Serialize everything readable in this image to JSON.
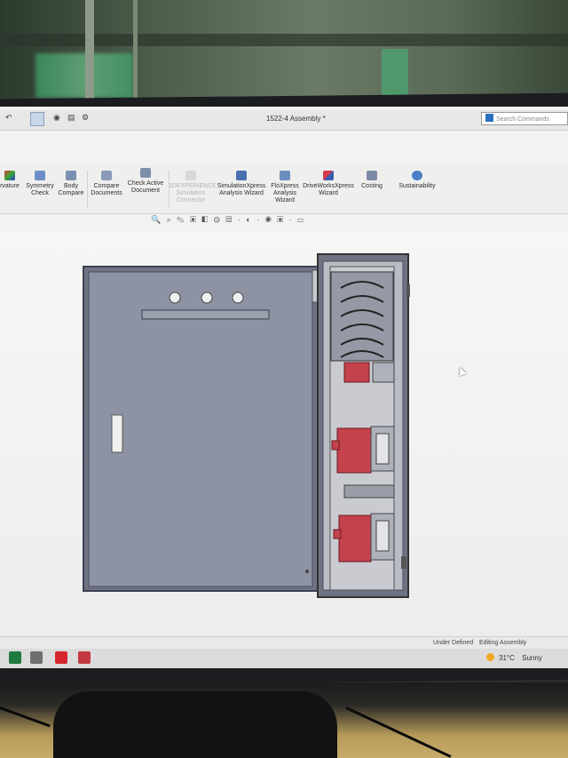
{
  "window": {
    "title": "1522-4 Assembly *"
  },
  "search": {
    "placeholder": "Search Commands"
  },
  "ribbon": {
    "items": [
      {
        "label": "rvature"
      },
      {
        "label": "Symmetry Check"
      },
      {
        "label": "Body Compare"
      },
      {
        "label": "Compare Documents"
      },
      {
        "label": "Check Active Document"
      },
      {
        "label": "3DEXPERIENCE Simulation Connector"
      },
      {
        "label": "SimulationXpress Analysis Wizard"
      },
      {
        "label": "FloXpress Analysis Wizard"
      },
      {
        "label": "DriveWorksXpress Wizard"
      },
      {
        "label": "Costing"
      },
      {
        "label": "Sustainability"
      }
    ]
  },
  "status": {
    "left": "Under Defined",
    "right": "Editing Assembly"
  },
  "weather": {
    "temp": "31°C",
    "condition": "Sunny"
  },
  "colors": {
    "panel": "#8e93a3",
    "breaker": "#c4424c",
    "background": "#f2f2f0"
  }
}
